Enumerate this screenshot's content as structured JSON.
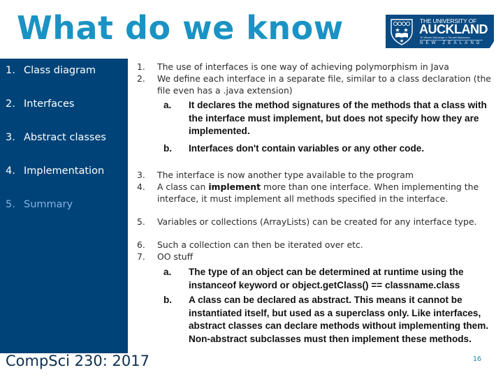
{
  "slide": {
    "title": "What do we know",
    "page_number": "16",
    "footer": "CompSci 230: 2017"
  },
  "logo": {
    "line1": "THE UNIVERSITY OF",
    "line2": "AUCKLAND",
    "line3": "Te Whare Wānanga o Tāmaki Makaurau",
    "line4": "NEW ZEALAND"
  },
  "sidebar": {
    "items": [
      {
        "num": "1.",
        "label": "Class diagram",
        "active": false
      },
      {
        "num": "2.",
        "label": "Interfaces",
        "active": false
      },
      {
        "num": "3.",
        "label": "Abstract classes",
        "active": false
      },
      {
        "num": "4.",
        "label": "Implementation",
        "active": false
      },
      {
        "num": "5.",
        "label": "Summary",
        "active": false,
        "dimmed": true
      }
    ]
  },
  "content": {
    "points": [
      {
        "num": "1.",
        "text": "The use of interfaces is one way of achieving polymorphism in Java"
      },
      {
        "num": "2.",
        "text": "We define each interface in a separate file, similar to a class declaration (the file even has a .java extension)",
        "sub": [
          {
            "num": "a.",
            "text": "It declares the method signatures of the methods that a class with the interface must implement, but does not specify how they are implemented."
          },
          {
            "num": "b.",
            "text": "Interfaces don't contain variables or any other code."
          }
        ]
      },
      {
        "num": "3.",
        "text": "The interface is now another type available to the program"
      },
      {
        "num": "4.",
        "text_before": "A class can ",
        "text_bold": "implement",
        "text_after": " more than one interface. When implementing the interface, it must implement all methods specified in the interface."
      },
      {
        "num": "5.",
        "text": "Variables or collections (ArrayLists) can be created for any interface type."
      },
      {
        "num": "6.",
        "text": "Such a collection can then be iterated over etc."
      },
      {
        "num": "7.",
        "text": "OO stuff",
        "sub": [
          {
            "num": "a.",
            "text": "The type of an object can be determined at runtime using the instanceof keyword or object.getClass() == classname.class"
          },
          {
            "num": "b.",
            "text_before": "A class can be declared as ",
            "text_bold": "abstract.",
            "text_after": " This means it cannot be instantiated itself, but used as a superclass only. Like interfaces, abstract classes can declare methods without implementing them. Non-abstract subclasses must then implement these methods."
          }
        ]
      }
    ]
  },
  "colors": {
    "title": "#1a93c4",
    "sidebar_bg": "#004378",
    "sidebar_text": "#ffffff",
    "sidebar_dim_text": "#7fb3e0",
    "logo_bg": "#0b4b83",
    "footer_text": "#0e2f4e",
    "page_number": "#2b86a8"
  }
}
